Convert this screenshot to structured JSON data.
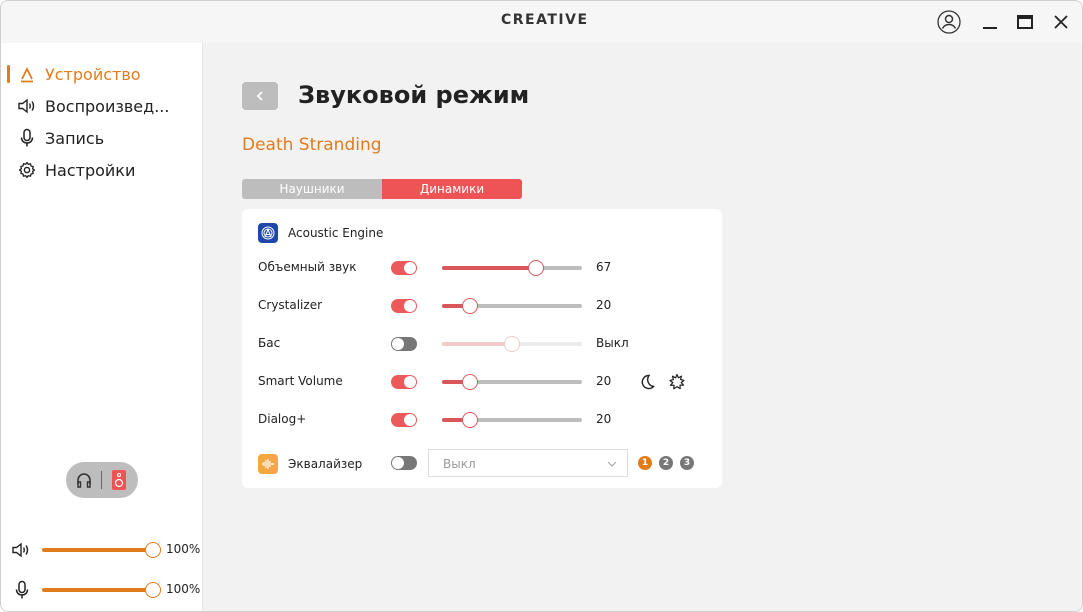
{
  "app": {
    "logo": "CREATIVE",
    "titlebar_icons": [
      "account-icon",
      "minimize-icon",
      "maximize-icon",
      "close-icon"
    ]
  },
  "sidebar": {
    "items": [
      {
        "label": "Устройство",
        "icon": "creative-logo-icon",
        "active": true
      },
      {
        "label": "Воспроизвед...",
        "icon": "speaker-icon",
        "active": false
      },
      {
        "label": "Запись",
        "icon": "microphone-icon",
        "active": false
      },
      {
        "label": "Настройки",
        "icon": "gear-icon",
        "active": false
      }
    ],
    "device_toggle": {
      "options": [
        "headphones",
        "speakers"
      ],
      "selected": "speakers"
    },
    "volume": {
      "playback_label": "100%",
      "playback_value": 100,
      "record_label": "100%",
      "record_value": 100
    }
  },
  "main": {
    "title": "Звуковой режим",
    "profile": "Death Stranding",
    "tabs": [
      {
        "label": "Наушники",
        "active": false
      },
      {
        "label": "Динамики",
        "active": true
      }
    ],
    "card": {
      "header": "Acoustic Engine",
      "rows": [
        {
          "name": "Объемный звук",
          "enabled": true,
          "value": 67,
          "display": "67"
        },
        {
          "name": "Crystalizer",
          "enabled": true,
          "value": 20,
          "display": "20"
        },
        {
          "name": "Бас",
          "enabled": false,
          "value": 50,
          "display": "Выкл"
        },
        {
          "name": "Smart Volume",
          "enabled": true,
          "value": 20,
          "display": "20",
          "extras": [
            "night-mode-icon",
            "loud-mode-icon"
          ]
        },
        {
          "name": "Dialog+",
          "enabled": true,
          "value": 20,
          "display": "20"
        }
      ],
      "equalizer": {
        "label": "Эквалайзер",
        "enabled": false,
        "selected": "Выкл",
        "presets": [
          {
            "label": "1",
            "active": true
          },
          {
            "label": "2",
            "active": false
          },
          {
            "label": "3",
            "active": false
          }
        ]
      }
    }
  },
  "colors": {
    "accent": "#e07c1c",
    "red": "#ee5456",
    "ae_blue": "#1e47a8",
    "eq_orange": "#f6a643"
  }
}
